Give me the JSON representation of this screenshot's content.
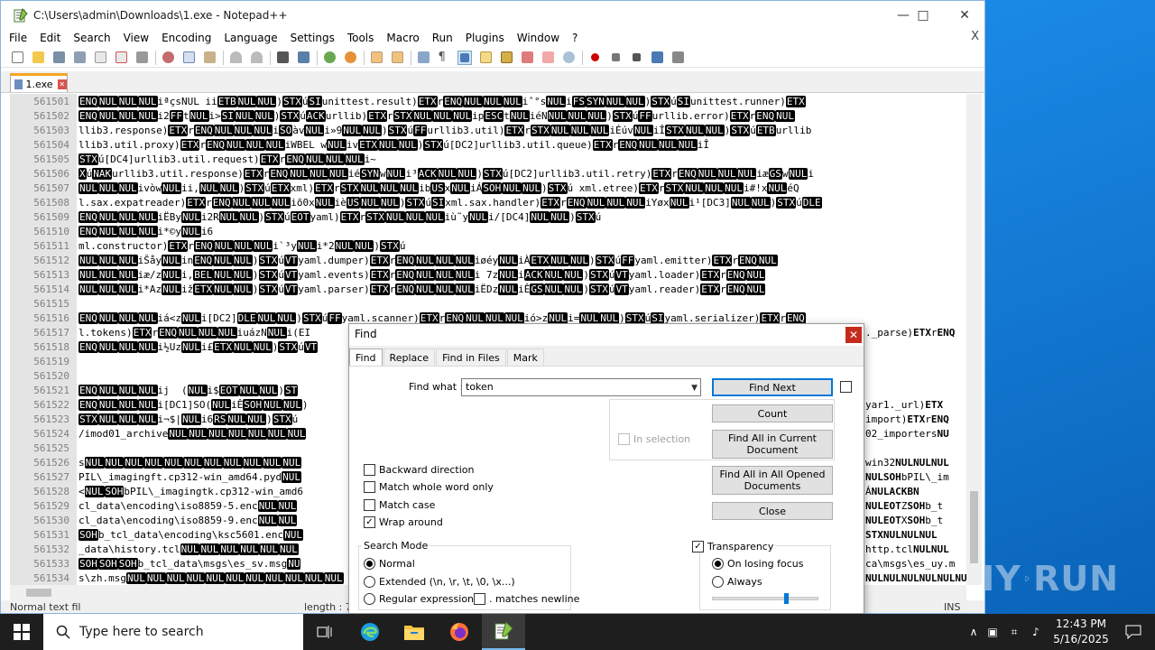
{
  "window": {
    "title": "C:\\Users\\admin\\Downloads\\1.exe - Notepad++"
  },
  "menu": [
    "File",
    "Edit",
    "Search",
    "View",
    "Encoding",
    "Language",
    "Settings",
    "Tools",
    "Macro",
    "Run",
    "Plugins",
    "Window",
    "?"
  ],
  "menu_close": "X",
  "tab": {
    "label": "1.exe"
  },
  "editor": {
    "lines": [
      {
        "n": "561501",
        "t": "[ENQ][NUL][NUL][NUL]iªçsNUL ii[ETB][NUL][NUL])[STX]ú[SI]unittest.result)[ETX]r[ENQ][NUL][NUL][NUL]iˆ°s[NUL]i[FS][SYN][NUL][NUL])[STX]ú[SI]unittest.runner)[ETX]"
      },
      {
        "n": "561502",
        "t": "[ENQ][NUL][NUL][NUL]i2[FF]t[NUL]i>[SI][NUL][NUL])[STX]ú[ACK]urllib)[ETX]r[STX][NUL][NUL][NUL]ip[ESC]t[NUL]iéN[NUL][NUL][NUL])[STX]ú[FF]urllib.error)[ETX]r[ENQ][NUL]"
      },
      {
        "n": "561503",
        "t": "llib3.response)[ETX]r[ENQ][NUL][NUL][NUL]i[SO]àv[NUL]i»9[NUL][NUL])[STX]ú[FF]urllib3.util)[ETX]r[STX][NUL][NUL][NUL]iÉúv[NUL]iÎ[STX][NUL][NUL])[STX]ú[ETB]urllib"
      },
      {
        "n": "561504",
        "t": "llib3.util.proxy)[ETX]r[ENQ][NUL][NUL][NUL]iWBEL w[NUL]iv[ETX][NUL][NUL])[STX]ú[DC2]urllib3.util.queue)[ETX]r[ENQ][NUL][NUL][NUL]iÎ"
      },
      {
        "n": "561505",
        "t": "[STX]ú[DC4]urllib3.util.request)[ETX]r[ENQ][NUL][NUL][NUL]i~"
      },
      {
        "n": "561506",
        "t": "[X]ú[NAK]urllib3.util.response)[ETX]r[ENQ][NUL][NUL][NUL]ié[SYN]w[NUL]i³[ACK][NUL][NUL])[STX]ú[DC2]urllib3.util.retry)[ETX]r[ENQ][NUL][NUL][NUL]iæ[GS]w[NUL]i"
      },
      {
        "n": "561507",
        "t": "[NUL][NUL][NUL]ivòw[NUL]ii,[NUL][NUL])[STX]ú[ETX]xml)[ETX]r[STX][NUL][NUL][NUL]ib[US]x[NUL]iÁ[SOH][NUL][NUL])[STX]ú xml.etree)[ETX]r[STX][NUL][NUL][NUL]i#!x[NUL]éQ"
      },
      {
        "n": "561508",
        "t": "l.sax.expatreader)[ETX]r[ENQ][NUL][NUL][NUL]iõ0x[NUL]iè[US][NUL][NUL])[STX]ú[SI]xml.sax.handler)[ETX]r[ENQ][NUL][NUL][NUL]iYøx[NUL]i¹[DC3][NUL][NUL])[STX]ú[DLE]"
      },
      {
        "n": "561509",
        "t": "[ENQ][NUL][NUL][NUL]iËBy[NUL]i2R[NUL][NUL])[STX]ú[EOT]yaml)[ETX]r[STX][NUL][NUL][NUL]iù˜y[NUL]i/[DC4][NUL][NUL])[STX]ú"
      },
      {
        "n": "561510",
        "t": "[ENQ][NUL][NUL][NUL]i*©y[NUL]i6"
      },
      {
        "n": "561511",
        "t": "ml.constructor)[ETX]r[ENQ][NUL][NUL][NUL]i`³y[NUL]i*2[NUL][NUL])[STX]ú"
      },
      {
        "n": "561512",
        "t": "[NUL][NUL][NUL]iŠåy[NUL]in[ENQ][NUL][NUL])[STX]ú[VT]yaml.dumper)[ETX]r[ENQ][NUL][NUL][NUL]iøéy[NUL]iÀ[ETX][NUL][NUL])[STX]ú[FF]yaml.emitter)[ETX]r[ENQ][NUL]"
      },
      {
        "n": "561513",
        "t": "[NUL][NUL][NUL]iæ/z[NUL]i,[BEL][NUL][NUL])[STX]ú[VT]yaml.events)[ETX]r[ENQ][NUL][NUL][NUL]i 7z[NUL]i[ACK][NUL][NUL])[STX]ú[VT]yaml.loader)[ETX]r[ENQ][NUL]"
      },
      {
        "n": "561514",
        "t": "[NUL][NUL][NUL]i*Az[NUL]iž[ETX][NUL][NUL])[STX]ú[VT]yaml.parser)[ETX]r[ENQ][NUL][NUL][NUL]iËDz[NUL]iÊ[GS][NUL][NUL])[STX]ú[VT]yaml.reader)[ETX]r[ENQ][NUL]"
      },
      {
        "n": "561515",
        "t": ""
      },
      {
        "n": "561516",
        "t": "[ENQ][NUL][NUL][NUL]iá<z[NUL]i[DC2][DLE][NUL][NUL])[STX]ú[FF]yaml.scanner)[ETX]r[ENQ][NUL][NUL][NUL]ió>z[NUL]i=[NUL][NUL])[STX]ú[SI]yaml.serializer)[ETX]r[ENQ]"
      },
      {
        "n": "561517",
        "t": "l.tokens)[ETX]r[ENQ][NUL][NUL][NUL]iuázN[NUL]i(EI"
      },
      {
        "n": "561518",
        "t": "[ENQ][NUL][NUL][NUL]i½Uz[NUL]i£[ETX][NUL][NUL])[STX]ú[VT]"
      },
      {
        "n": "561519",
        "t": ""
      },
      {
        "n": "561520",
        "t": ""
      },
      {
        "n": "561521",
        "t": "[ENQ][NUL][NUL][NUL]ij  ([NUL]i$[EOT][NUL][NUL])[ST]"
      },
      {
        "n": "561522",
        "t": "[ENQ][NUL][NUL][NUL]i[DC1]SO([NUL]iÊ[SOH][NUL][NUL])"
      },
      {
        "n": "561523",
        "t": "[STX][NUL][NUL][NUL]i¬$|[NUL]i6[RS][NUL][NUL])[STX]ú"
      },
      {
        "n": "561524",
        "t": "/imod01_archive[NUL][NUL][NUL][NUL][NUL][NUL][NUL]"
      },
      {
        "n": "561525",
        "t": ""
      },
      {
        "n": "561526",
        "t": "s[NUL][NUL][NUL][NUL][NUL][NUL][NUL][NUL][NUL][NUL][NUL]"
      },
      {
        "n": "561527",
        "t": "PIL\\_imagingft.cp312-win_amd64.pyd[NUL]"
      },
      {
        "n": "561528",
        "t": "<[NUL][SOH]bPIL\\_imagingtk.cp312-win_amd6"
      },
      {
        "n": "561529",
        "t": "cl_data\\encoding\\iso8859-5.enc[NUL][NUL]"
      },
      {
        "n": "561530",
        "t": "cl_data\\encoding\\iso8859-9.enc[NUL][NUL]"
      },
      {
        "n": "561531",
        "t": "[SOH]b_tcl_data\\encoding\\ksc5601.enc[NUL]"
      },
      {
        "n": "561532",
        "t": "_data\\history.tcl[NUL][NUL][NUL][NUL][NUL][NUL]"
      },
      {
        "n": "561533",
        "t": "[SOH][SOH][SOH]b_tcl_data\\msgs\\es_sv.msg[NU]"
      },
      {
        "n": "561534",
        "t": "s\\zh.msg[NUL][NUL][NUL][NUL][NUL][NUL][NUL][NUL][NUL][NUL][NUL]"
      }
    ],
    "right_fragments": [
      {
        "row": 16,
        "t": "._parse)[ETX]r[ENQ]"
      },
      {
        "row": 21,
        "t": "yar1._url)[ETX]"
      },
      {
        "row": 22,
        "t": "import)[ETX]r[ENQ]"
      },
      {
        "row": 23,
        "t": "02_importers[NU]"
      },
      {
        "row": 25,
        "t": "win32[NUL][NUL][NUL]"
      },
      {
        "row": 26,
        "t": "[NUL][SOH]bPIL\\_im"
      },
      {
        "row": 27,
        "t": "Á[NUL][ACK][BN]"
      },
      {
        "row": 28,
        "t": "[NUL][EOT]Z[SOH]b_t"
      },
      {
        "row": 29,
        "t": "[NUL][EOT]X[SOH]b_t"
      },
      {
        "row": 30,
        "t": "[STX][NUL][NUL][NUL]"
      },
      {
        "row": 31,
        "t": "http.tcl[NUL][NUL]"
      },
      {
        "row": 32,
        "t": "ca\\msgs\\es_uy.m"
      },
      {
        "row": 33,
        "t": "[NUL][NUL][NUL][NUL][NUL][NUL]"
      }
    ]
  },
  "statusbar": {
    "left": "Normal text fil",
    "length": "length : 7",
    "ins": "INS"
  },
  "find": {
    "title": "Find",
    "tabs": [
      "Find",
      "Replace",
      "Find in Files",
      "Mark"
    ],
    "find_what_label": "Find what :",
    "find_what_value": "token",
    "buttons": {
      "find_next": "Find Next",
      "count": "Count",
      "find_all_current": "Find All in Current Document",
      "find_all_opened": "Find All in All Opened Documents",
      "close": "Close"
    },
    "in_selection": "In selection",
    "options": {
      "backward": "Backward direction",
      "whole_word": "Match whole word only",
      "match_case": "Match case",
      "wrap_around": "Wrap around"
    },
    "search_mode": {
      "title": "Search Mode",
      "normal": "Normal",
      "extended": "Extended (\\n, \\r, \\t, \\0, \\x...)",
      "regex": "Regular expression",
      "matches_newline": ". matches newline"
    },
    "transparency": {
      "title": "Transparency",
      "on_losing_focus": "On losing focus",
      "always": "Always",
      "level": 0.7
    }
  },
  "taskbar": {
    "search_placeholder": "Type here to search",
    "time": "12:43 PM",
    "date": "5/16/2025"
  },
  "watermark": "ANY RUN"
}
